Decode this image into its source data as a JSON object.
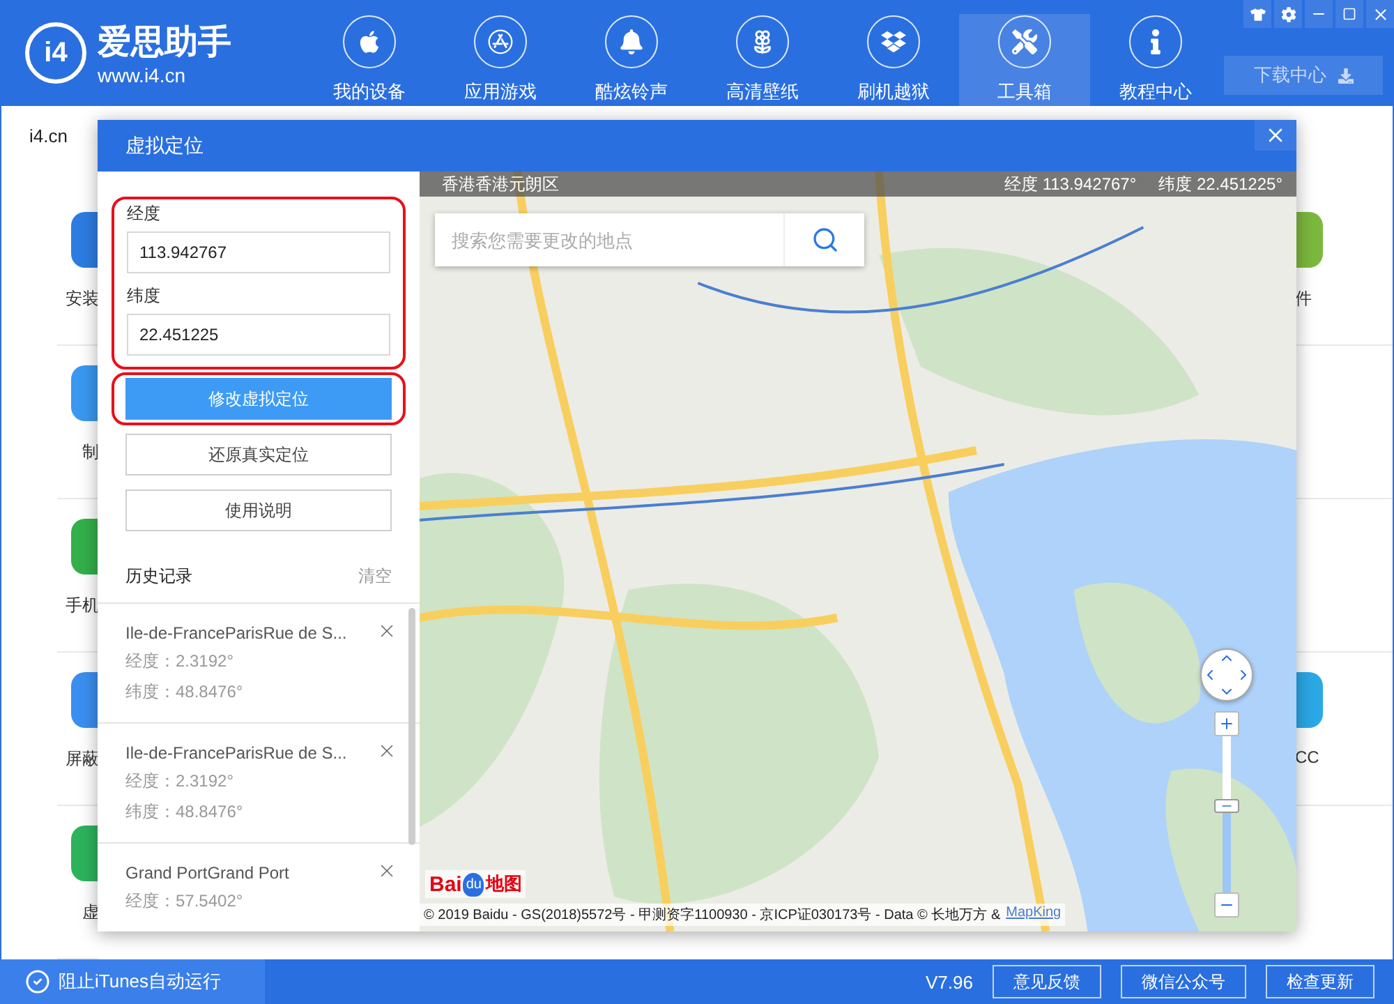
{
  "header": {
    "logo": {
      "mark": "i4",
      "name": "爱思助手",
      "url": "www.i4.cn"
    },
    "nav": [
      {
        "label": "我的设备",
        "selected": false
      },
      {
        "label": "应用游戏",
        "selected": false
      },
      {
        "label": "酷炫铃声",
        "selected": false
      },
      {
        "label": "高清壁纸",
        "selected": false
      },
      {
        "label": "刷机越狱",
        "selected": false
      },
      {
        "label": "工具箱",
        "selected": true
      },
      {
        "label": "教程中心",
        "selected": false
      }
    ],
    "download_button": "下载中心"
  },
  "tab": "i4.cn",
  "background": {
    "left_items": [
      {
        "label": "安装",
        "color": "#2e7ce2"
      },
      {
        "label": "制",
        "color": "#3a98f0"
      },
      {
        "label": "手机",
        "color": "#33b04a"
      },
      {
        "label": "屏蔽",
        "color": "#3b8ff0"
      },
      {
        "label": "虚",
        "color": "#2db35c"
      }
    ],
    "right_items": [
      {
        "kind": "app",
        "label": "件",
        "color": "#7cb83e"
      },
      {
        "kind": "blank"
      },
      {
        "kind": "blank"
      },
      {
        "kind": "app",
        "label": "CC",
        "color": "#2ba8e6"
      }
    ]
  },
  "dialog": {
    "title": "虚拟定位",
    "longitude": {
      "label": "经度",
      "value": "113.942767"
    },
    "latitude": {
      "label": "纬度",
      "value": "22.451225"
    },
    "fields_highlighted": true,
    "buttons": [
      {
        "label": "修改虚拟定位",
        "kind": "primary",
        "highlighted": true
      },
      {
        "label": "还原真实定位",
        "kind": "plain",
        "highlighted": false
      },
      {
        "label": "使用说明",
        "kind": "plain",
        "highlighted": false
      }
    ],
    "history": {
      "title": "历史记录",
      "clear": "清空",
      "items": [
        {
          "title": "Ile-de-FranceParisRue de S...",
          "longitude": "经度：2.3192°",
          "latitude": "纬度：48.8476°"
        },
        {
          "title": "Ile-de-FranceParisRue de S...",
          "longitude": "经度：2.3192°",
          "latitude": "纬度：48.8476°"
        },
        {
          "title": "Grand PortGrand Port",
          "longitude": "经度：57.5402°"
        }
      ]
    },
    "map": {
      "region": "香港香港元朗区",
      "longitude": "经度 113.942767°",
      "latitude": "纬度 22.451225°",
      "search": {
        "placeholder": "搜索您需要更改的地点"
      },
      "zoom_slider": {
        "level": 0.56
      },
      "logo": {
        "bai": "Bai",
        "du": "du",
        "suffix": "地图"
      },
      "copyright": "© 2019 Baidu - GS(2018)5572号 - 甲测资字1100930 - 京ICP证030173号 - Data © 长地万方 &",
      "copyright_link": "MapKing"
    }
  },
  "status_bar": {
    "itunes_block": {
      "label": "阻止iTunes自动运行",
      "checked": true
    },
    "version": "V7.96",
    "buttons": [
      "意见反馈",
      "微信公众号",
      "检查更新"
    ]
  }
}
